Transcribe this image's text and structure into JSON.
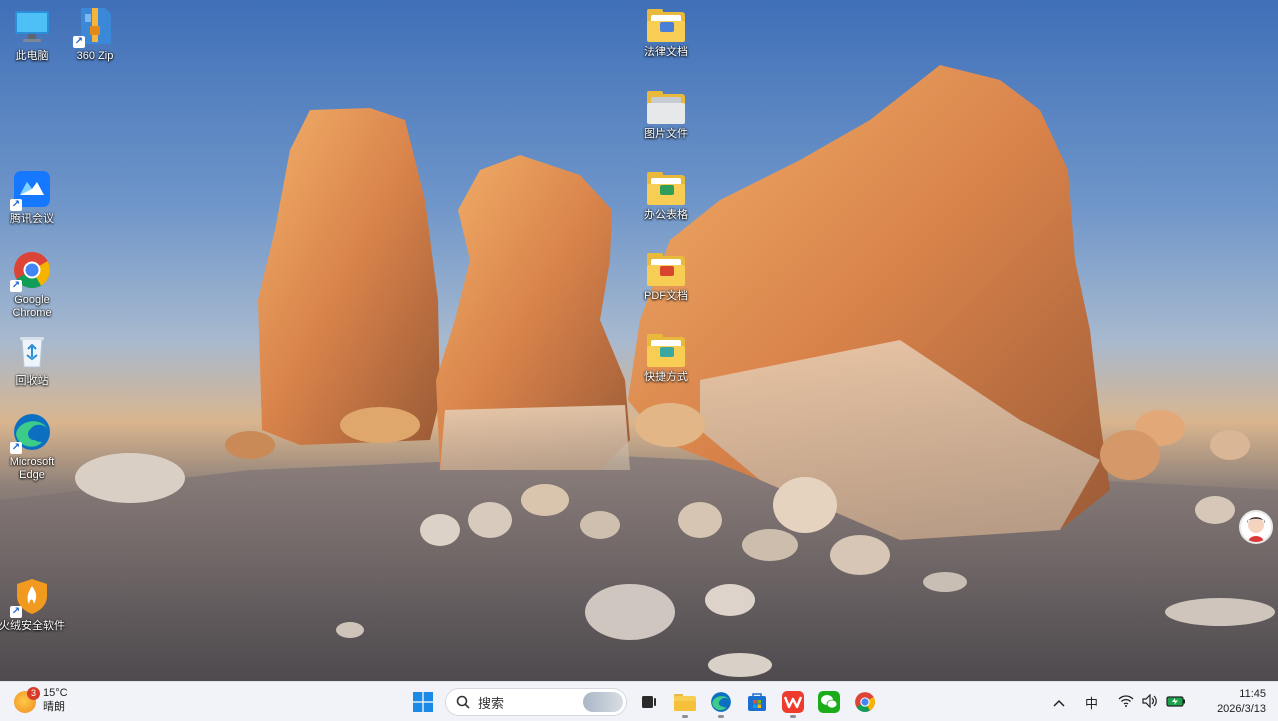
{
  "desktop": {
    "left_icons": [
      {
        "label": "此电脑"
      },
      {
        "label": "360 Zip"
      },
      {
        "label": "腾讯会议"
      },
      {
        "label": "Google Chrome"
      },
      {
        "label": "回收站"
      },
      {
        "label": "Microsoft Edge"
      },
      {
        "label": "火绒安全软件"
      }
    ],
    "folders": [
      {
        "label": "法律文档"
      },
      {
        "label": "图片文件"
      },
      {
        "label": "办公表格"
      },
      {
        "label": "PDF文档"
      },
      {
        "label": "快捷方式"
      }
    ]
  },
  "taskbar": {
    "weather": {
      "temp": "15°C",
      "condition": "晴朗",
      "badge": "3"
    },
    "search_label": "搜索",
    "apps": [
      "windows-start",
      "search",
      "task-view",
      "file-explorer",
      "edge",
      "microsoft-store",
      "wps",
      "wechat",
      "chrome"
    ],
    "tray": {
      "ime": "中"
    },
    "clock": {
      "time": "11:45",
      "date": "2026/3/13"
    }
  },
  "colors": {
    "taskbar_bg": "#f1f3f8",
    "folder_yellow": "#f7cd54",
    "sky_top": "#3f6fb8"
  }
}
